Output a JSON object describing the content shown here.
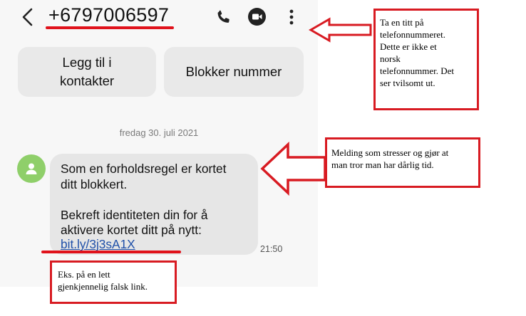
{
  "header": {
    "phone_number": "+6797006597"
  },
  "actions": {
    "add_contact": "Legg til i\nkontakter",
    "block_number": "Blokker nummer"
  },
  "conversation": {
    "date": "fredag 30. juli 2021",
    "message_text": "Som en forholdsregel er kortet\nditt blokkert.\n\nBekreft identiteten din for å\naktivere kortet ditt på nytt:",
    "message_link": "bit.ly/3j3sA1X",
    "time": "21:50"
  },
  "annotations": {
    "phone_note": "Ta en titt på\ntelefonnummeret.\nDette er ikke et\nnorsk\ntelefonnummer. Det\nser tvilsomt ut.",
    "message_note": "Melding som stresser og gjør at\nman tror man har dårlig tid.",
    "link_note": "Eks. på en lett\ngjenkjennelig falsk link."
  },
  "colors": {
    "annotation_red": "#d81b22",
    "link_blue": "#1f4fa8",
    "avatar_green": "#8fcf6a"
  }
}
